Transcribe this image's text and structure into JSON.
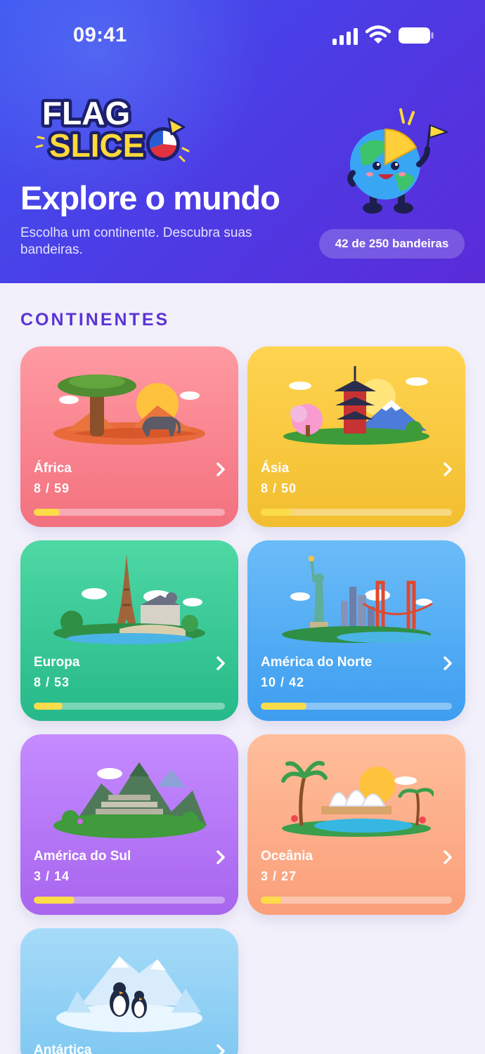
{
  "status_bar": {
    "time": "09:41"
  },
  "header": {
    "logo_line1": "FLAG",
    "logo_line2": "SLICE",
    "title": "Explore o mundo",
    "subtitle": "Escolha um continente. Descubra suas bandeiras.",
    "progress_pill": "42 de 250 bandeiras"
  },
  "section": {
    "title": "CONTINENTES"
  },
  "continents": [
    {
      "name": "África",
      "count": "8 / 59",
      "progress": 0.136
    },
    {
      "name": "Ásia",
      "count": "8 / 50",
      "progress": 0.16
    },
    {
      "name": "Europa",
      "count": "8 / 53",
      "progress": 0.151
    },
    {
      "name": "América do Norte",
      "count": "10 / 42",
      "progress": 0.238
    },
    {
      "name": "América do Sul",
      "count": "3 / 14",
      "progress": 0.214
    },
    {
      "name": "Oceânia",
      "count": "3 / 27",
      "progress": 0.111
    },
    {
      "name": "Antártica",
      "count": "",
      "progress": 0
    }
  ],
  "colors": {
    "header_start": "#3d55f0",
    "header_end": "#5a2bd8",
    "section_title": "#5b34d6",
    "progress_fill": "#fddc4a",
    "background": "#f2f1fb"
  }
}
